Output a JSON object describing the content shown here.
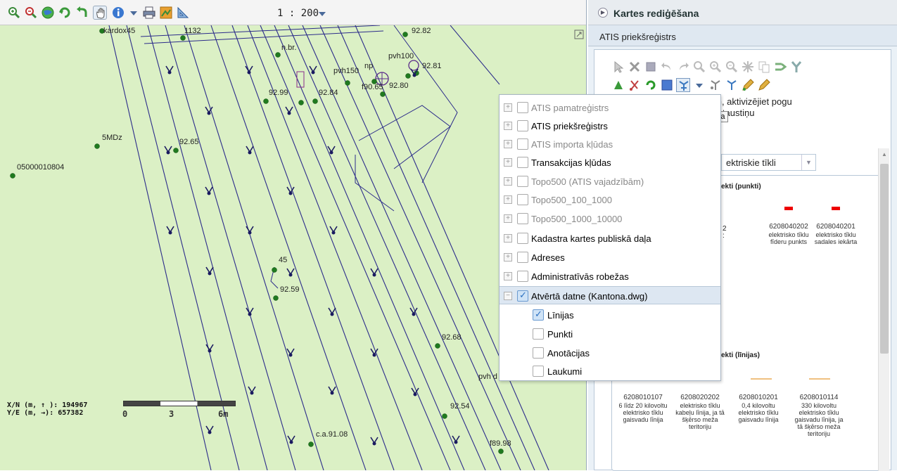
{
  "map": {
    "scale_text": "1 : 200",
    "labels": [
      "kardox45",
      "1132",
      "n.br.",
      "92.82",
      "pvh100",
      "92.81",
      "pvh150",
      "np",
      "f90.65",
      "92.80",
      "92.99",
      "92.84",
      "5MDz",
      "92.65",
      "05000010804",
      "45",
      "92.59",
      "92.68",
      "pvh d",
      "92.54",
      "c.a.91.08",
      "f89.98"
    ],
    "coords": {
      "xn": "X/N (m, ↑ ): 194967",
      "ye": "Y/E (m, →): 657382"
    },
    "scalebar": {
      "l0": "0",
      "l3": "3",
      "l6": "6m"
    },
    "colors": {
      "map_bg": "#dbf0c5",
      "line": "#2b2b8a",
      "point": "#1f7a1f",
      "cross": "#1a1a60"
    }
  },
  "toolbar": {
    "icons": [
      "zoom-in-icon",
      "zoom-out-icon",
      "globe-icon",
      "refresh-icon",
      "back-icon",
      "pan-hand-icon",
      "info-icon",
      "dropdown-icon",
      "print-icon",
      "map-export-icon",
      "measure-icon"
    ]
  },
  "right_panel": {
    "title": "Kartes rediģēšana",
    "subtitle": "ATIS priekšreģistrs",
    "hint_line1": "mentam, aktivizējiet pogu",
    "hint_line2": "u CTRL taustiņu",
    "tooltip": "Lipšana",
    "tab_select": "ektriskie tīkli",
    "section_points": "ekti (punkti)",
    "section_lines": "ekti (līnijas)",
    "point_items": [
      {
        "code": "6208040202",
        "desc": "elektrisko tīklu fīderu punkts"
      },
      {
        "code": "6208040201",
        "desc": "elektrisko tīklu sadales iekārta"
      }
    ],
    "point_partial": [
      "2",
      ":"
    ],
    "line_items": [
      {
        "code": "6208010107",
        "desc": "6 līdz 20 kilovoltu elektrisko tīklu gaisvadu līnija"
      },
      {
        "code": "6208020202",
        "desc": "elektrisko tīklu kabeļu līnija, ja tā šķērso meža teritoriju"
      },
      {
        "code": "6208010201",
        "desc": "0,4 kilovoltu elektrisko tīklu gaisvadu līnija"
      },
      {
        "code": "6208010114",
        "desc": "330 kilovoltu elektrisko tīklu gaisvadu līnija, ja tā šķērso meža teritoriju"
      }
    ]
  },
  "layers": {
    "items": [
      {
        "label": "ATIS pamatreģistrs",
        "dim": true
      },
      {
        "label": "ATIS priekšreģistrs",
        "dim": false
      },
      {
        "label": "ATIS importa kļūdas",
        "dim": true
      },
      {
        "label": "Transakcijas kļūdas",
        "dim": false
      },
      {
        "label": "Topo500 (ATIS vajadzībām)",
        "dim": true
      },
      {
        "label": "Topo500_100_1000",
        "dim": true
      },
      {
        "label": "Topo500_1000_10000",
        "dim": true
      },
      {
        "label": "Kadastra kartes publiskā daļa",
        "dim": false
      },
      {
        "label": "Adreses",
        "dim": false
      },
      {
        "label": "Administratīvās robežas",
        "dim": false
      }
    ],
    "opened": {
      "label": "Atvērtā datne (Kantona.dwg)",
      "checked": true
    },
    "sublayers": [
      {
        "label": "Līnijas",
        "checked": true
      },
      {
        "label": "Punkti",
        "checked": false
      },
      {
        "label": "Anotācijas",
        "checked": false
      },
      {
        "label": "Laukumi",
        "checked": false
      }
    ]
  }
}
